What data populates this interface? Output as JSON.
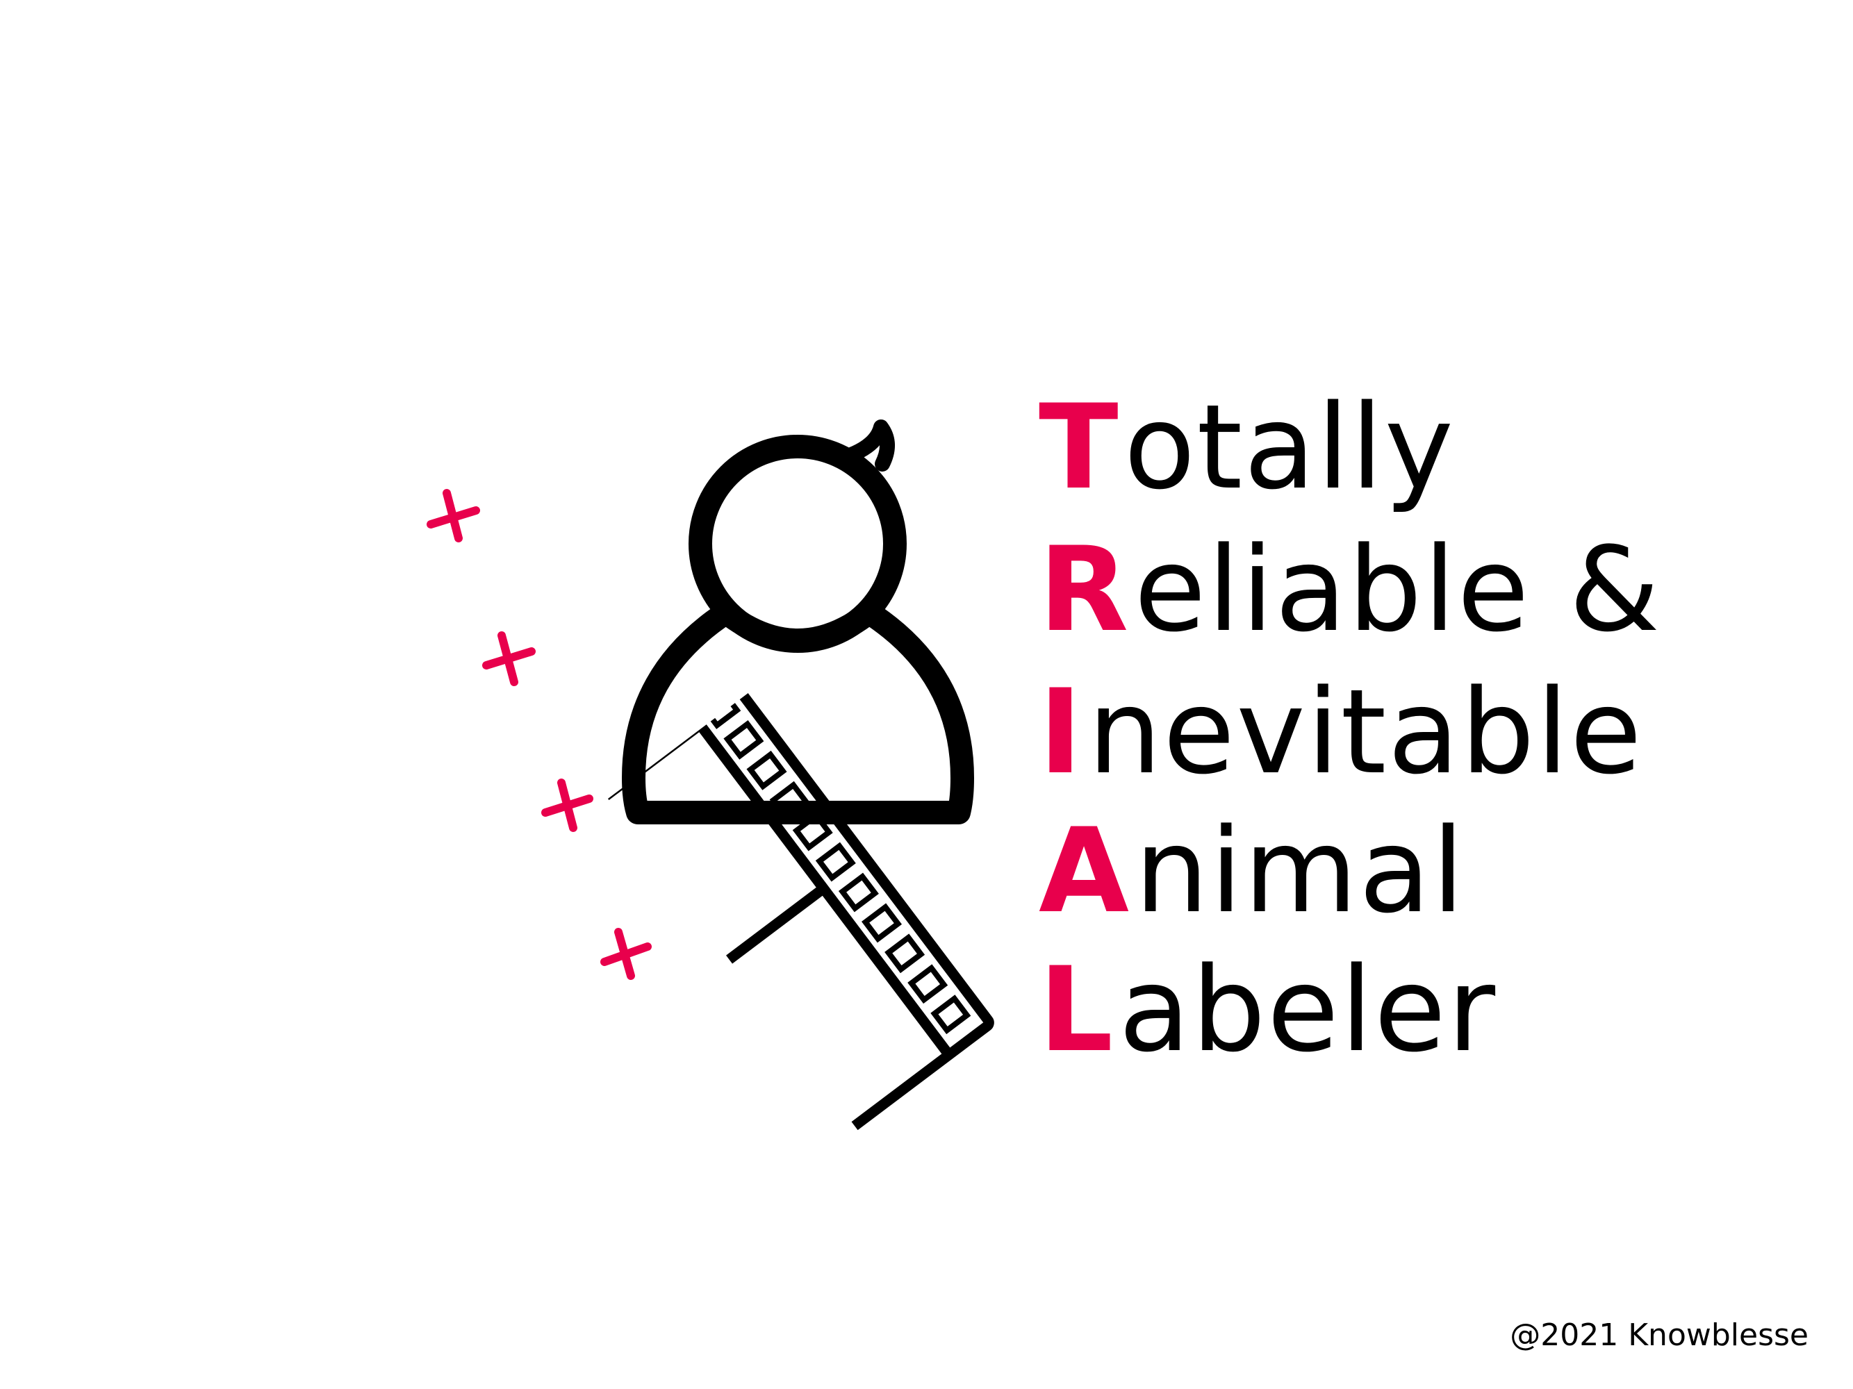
{
  "acronym": {
    "accent_color": "#e8004c",
    "text_color": "#000000",
    "lines": [
      {
        "initial": "T",
        "rest": "otally"
      },
      {
        "initial": "R",
        "rest": "eliable &"
      },
      {
        "initial": "I",
        "rest": "nevitable"
      },
      {
        "initial": "A",
        "rest": "nimal"
      },
      {
        "initial": "L",
        "rest": "abeler"
      }
    ]
  },
  "illustration": {
    "icons": [
      "film-strip-icon",
      "person-icon"
    ],
    "mark_count": 4,
    "stroke_color": "#000000",
    "mark_color": "#e8004c"
  },
  "footer": {
    "copyright": "@2021 Knowblesse"
  }
}
